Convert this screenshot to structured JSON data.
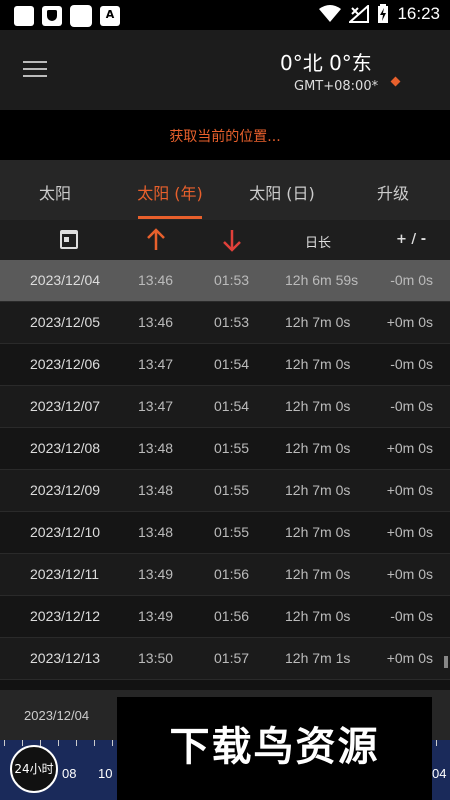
{
  "status_bar": {
    "time": "16:23"
  },
  "header": {
    "coords": "0°北  0°东",
    "timezone": "GMT+08:00*"
  },
  "location_prompt": "获取当前的位置...",
  "tabs": [
    {
      "label": "太阳",
      "active": false
    },
    {
      "label": "太阳 (年)",
      "active": true
    },
    {
      "label": "太阳 (日)",
      "active": false
    },
    {
      "label": "升级",
      "active": false
    }
  ],
  "columns": {
    "day_length": "日长",
    "diff": "+ / -"
  },
  "colors": {
    "accent": "#e8602c",
    "sunset_arrow": "#e0403a"
  },
  "rows": [
    {
      "date": "2023/12/04",
      "sunrise": "13:46",
      "sunset": "01:53",
      "length": "12h 6m 59s",
      "diff": "-0m 0s",
      "selected": true
    },
    {
      "date": "2023/12/05",
      "sunrise": "13:46",
      "sunset": "01:53",
      "length": "12h 7m 0s",
      "diff": "+0m 0s"
    },
    {
      "date": "2023/12/06",
      "sunrise": "13:47",
      "sunset": "01:54",
      "length": "12h 7m 0s",
      "diff": "-0m 0s"
    },
    {
      "date": "2023/12/07",
      "sunrise": "13:47",
      "sunset": "01:54",
      "length": "12h 7m 0s",
      "diff": "-0m 0s"
    },
    {
      "date": "2023/12/08",
      "sunrise": "13:48",
      "sunset": "01:55",
      "length": "12h 7m 0s",
      "diff": "+0m 0s"
    },
    {
      "date": "2023/12/09",
      "sunrise": "13:48",
      "sunset": "01:55",
      "length": "12h 7m 0s",
      "diff": "+0m 0s"
    },
    {
      "date": "2023/12/10",
      "sunrise": "13:48",
      "sunset": "01:55",
      "length": "12h 7m 0s",
      "diff": "+0m 0s"
    },
    {
      "date": "2023/12/11",
      "sunrise": "13:49",
      "sunset": "01:56",
      "length": "12h 7m 0s",
      "diff": "+0m 0s"
    },
    {
      "date": "2023/12/12",
      "sunrise": "13:49",
      "sunset": "01:56",
      "length": "12h 7m 0s",
      "diff": "-0m 0s"
    },
    {
      "date": "2023/12/13",
      "sunrise": "13:50",
      "sunset": "01:57",
      "length": "12h 7m 1s",
      "diff": "+0m 0s"
    }
  ],
  "bottom": {
    "date": "2023/12/04",
    "clock_label": "24小时",
    "timeline_labels": [
      "08",
      "10",
      "04"
    ]
  },
  "watermark": "下载鸟资源"
}
